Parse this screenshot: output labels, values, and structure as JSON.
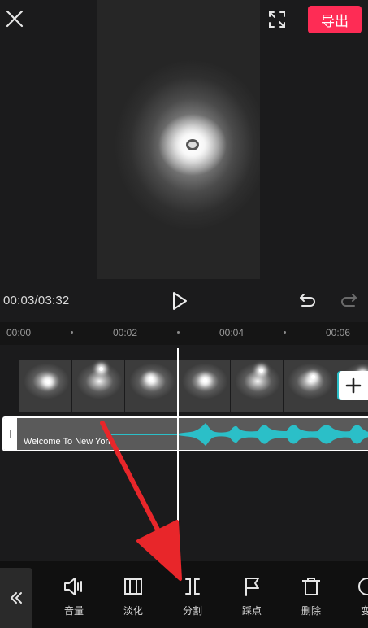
{
  "header": {
    "close_icon": "close-icon",
    "fullscreen_icon": "fullscreen-icon",
    "export_label": "导出"
  },
  "player": {
    "time": "00:03/03:32",
    "play_icon": "play-icon",
    "undo_icon": "undo-icon",
    "redo_icon": "redo-icon"
  },
  "timeline": {
    "ticks": [
      "00:00",
      "00:02",
      "00:04",
      "00:06"
    ],
    "audio_title": "Welcome To New York",
    "add_icon": "plus-icon"
  },
  "toolbar": {
    "collapse_icon": "double-chevron-left-icon",
    "items": [
      {
        "label": "音量",
        "icon": "volume-icon"
      },
      {
        "label": "淡化",
        "icon": "fade-icon"
      },
      {
        "label": "分割",
        "icon": "split-icon"
      },
      {
        "label": "踩点",
        "icon": "beat-flag-icon"
      },
      {
        "label": "删除",
        "icon": "delete-icon"
      },
      {
        "label": "变",
        "icon": "speed-icon"
      }
    ]
  },
  "colors": {
    "accent": "#fe2c55",
    "waveform": "#2bbfc8",
    "annotation": "#e8262a"
  }
}
